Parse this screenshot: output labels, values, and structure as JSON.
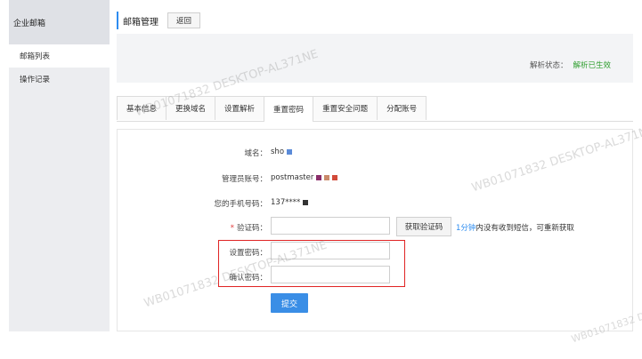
{
  "sidebar": {
    "header": "企业邮箱",
    "items": [
      {
        "label": "邮箱列表"
      },
      {
        "label": "操作记录"
      }
    ]
  },
  "header": {
    "title": "邮箱管理",
    "back_label": "返回"
  },
  "status": {
    "label": "解析状态：",
    "value": "解析已生效"
  },
  "tabs": [
    {
      "label": "基本信息"
    },
    {
      "label": "更换域名"
    },
    {
      "label": "设置解析"
    },
    {
      "label": "重置密码"
    },
    {
      "label": "重置安全问题"
    },
    {
      "label": "分配账号"
    }
  ],
  "form": {
    "domain_label": "域名：",
    "domain_value": "sho",
    "admin_label": "管理员账号：",
    "admin_value": "postmaster",
    "phone_label": "您的手机号码：",
    "phone_value": "137****",
    "code_label": "验证码：",
    "get_code_label": "获取验证码",
    "hint_time": "1分钟",
    "hint_text": "内没有收到短信，可重新获取",
    "new_pwd_label": "设置密码：",
    "confirm_pwd_label": "确认密码：",
    "submit_label": "提交"
  },
  "watermark": "WB01071832 DESKTOP-AL371NE",
  "colors": {
    "accent": "#2d8cf0",
    "success": "#2e9e2e",
    "highlight": "#e02424",
    "submit": "#3a8ee6"
  }
}
